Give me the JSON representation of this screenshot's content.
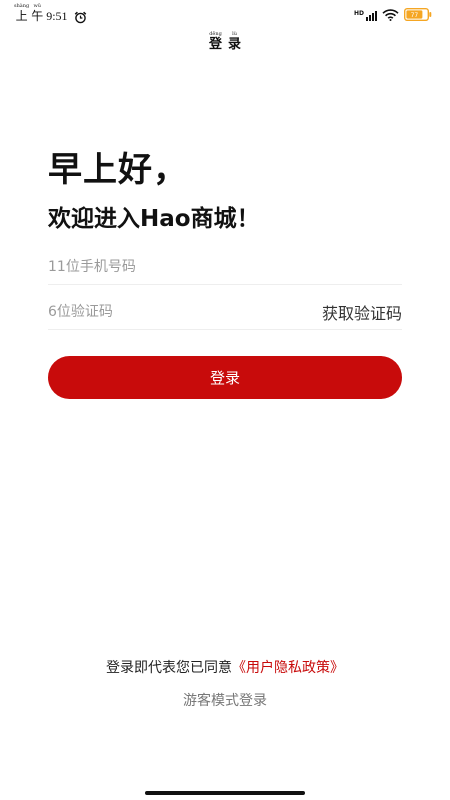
{
  "status_bar": {
    "period": [
      {
        "pinyin": "shàng",
        "char": "上"
      },
      {
        "pinyin": "wǔ",
        "char": "午"
      }
    ],
    "time": "9:51",
    "network_label": "HD",
    "battery_level": "77"
  },
  "header": {
    "title": [
      {
        "pinyin": "dēng",
        "char": "登"
      },
      {
        "pinyin": "lù",
        "char": "录"
      }
    ]
  },
  "greeting": "早上好，",
  "welcome": "欢迎进入Hao商城！",
  "phone_input": {
    "placeholder": "11位手机号码",
    "value": ""
  },
  "code_input": {
    "placeholder": "6位验证码",
    "value": ""
  },
  "get_code_label": "获取验证码",
  "login_label": "登录",
  "agreement": {
    "prefix": "登录即代表您已同意",
    "link": "《用户隐私政策》"
  },
  "guest_login_label": "游客模式登录",
  "colors": {
    "accent": "#c80b0b",
    "text": "#111111",
    "placeholder": "#9a9a9a",
    "divider": "#eeeeee",
    "battery": "#f5a623"
  }
}
